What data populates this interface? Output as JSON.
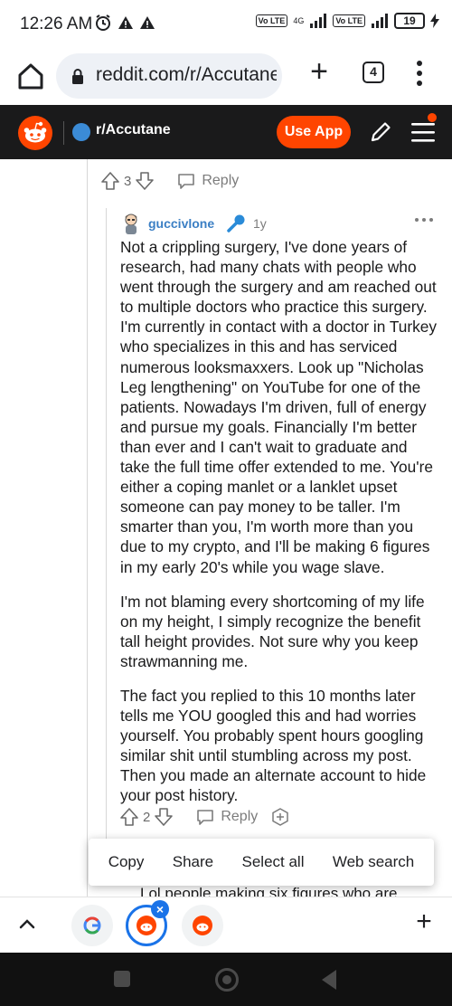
{
  "status_bar": {
    "time": "12:26 AM",
    "network": "4G",
    "volte_1": "Vo LTE",
    "volte_2": "Vo LTE",
    "battery": "19"
  },
  "browser": {
    "url": "reddit.com/r/Accutane",
    "tab_count": "4"
  },
  "reddit_header": {
    "subreddit": "r/Accutane",
    "use_app_label": "Use App"
  },
  "parent_actions": {
    "vote_count": "3",
    "reply_label": "Reply"
  },
  "comment": {
    "username": "guccivlone",
    "age": "1y",
    "paragraphs": [
      "Not a crippling surgery, I've done years of research, had many chats with people who went through the surgery and am reached out to multiple doctors who practice this surgery. I'm currently in contact with a doctor in Turkey who specializes in this and has serviced numerous looksmaxxers. Look up \"Nicholas Leg lengthening\" on YouTube for one of the patients. Nowadays I'm driven, full of energy and pursue my goals. Financially I'm better than ever and I can't wait to graduate and take the full time offer extended to me. You're either a coping manlet or a lanklet upset someone can pay money to be taller. I'm smarter than you, I'm worth more than you due to my crypto, and I'll be making 6 figures in my early 20's while you wage slave.",
      "I'm not blaming every shortcoming of my life on my height, I simply recognize the benefit tall height provides. Not sure why you keep strawmanning me.",
      "The fact you replied to this 10 months later tells me YOU googled this and had worries yourself. You probably spent hours googling similar shit until stumbling across my post. Then you made an alternate account to hide your post history."
    ],
    "vote_count": "2",
    "reply_label": "Reply"
  },
  "context_menu": {
    "items": [
      "Copy",
      "Share",
      "Select all",
      "Web search"
    ]
  },
  "next_comment_preview": "Lol people making six figures who are",
  "colors": {
    "reddit_orange": "#ff4500",
    "header_bg": "#1a1a1b",
    "link_blue": "#3b7fc4",
    "active_tab_ring": "#1a73e8"
  }
}
